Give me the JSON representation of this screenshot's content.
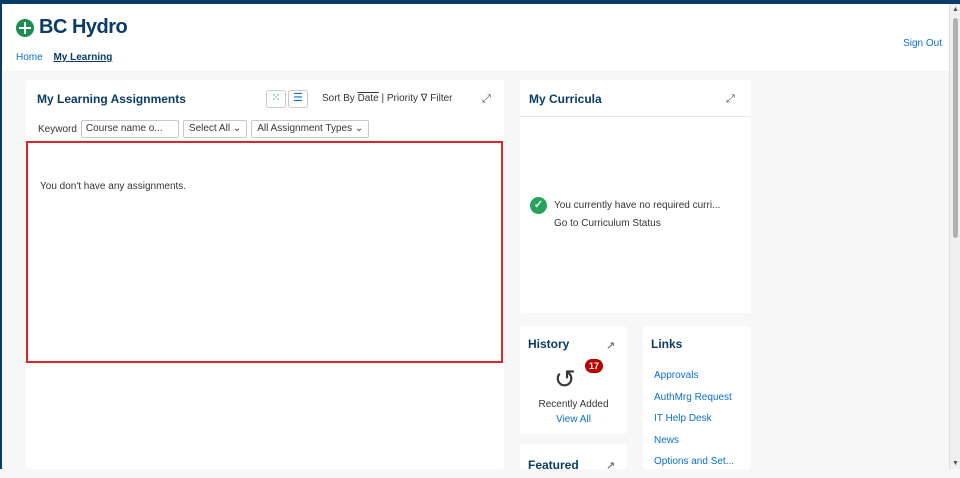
{
  "brand": {
    "name": "BC Hydro"
  },
  "breadcrumb": {
    "home": "Home",
    "current": "My Learning"
  },
  "header": {
    "sign_out": "Sign Out"
  },
  "assignments": {
    "title": "My Learning Assignments",
    "sort_by": "Sort By",
    "sort_date": "Date",
    "sort_separator": "|",
    "sort_priority": "Priority",
    "filter": "Filter",
    "keyword_label": "Keyword",
    "keyword_placeholder": "Course name o...",
    "select_all": "Select All",
    "assignment_types": "All Assignment Types",
    "empty_message": "You don't have any assignments."
  },
  "curricula": {
    "title": "My Curricula",
    "message": "You currently have no required curri...",
    "link": "Go to Curriculum Status"
  },
  "history": {
    "title": "History",
    "badge": "17",
    "label": "Recently Added",
    "link": "View All"
  },
  "featured": {
    "title": "Featured"
  },
  "links": {
    "title": "Links",
    "items": [
      "Approvals",
      "AuthMrg Request",
      "IT Help Desk",
      "News",
      "Options and Set..."
    ]
  },
  "colors": {
    "brand": "#0a3b66",
    "link": "#0a6ed1",
    "highlight": "#e0232d",
    "success": "#26a35b",
    "badge": "#bb0000"
  }
}
